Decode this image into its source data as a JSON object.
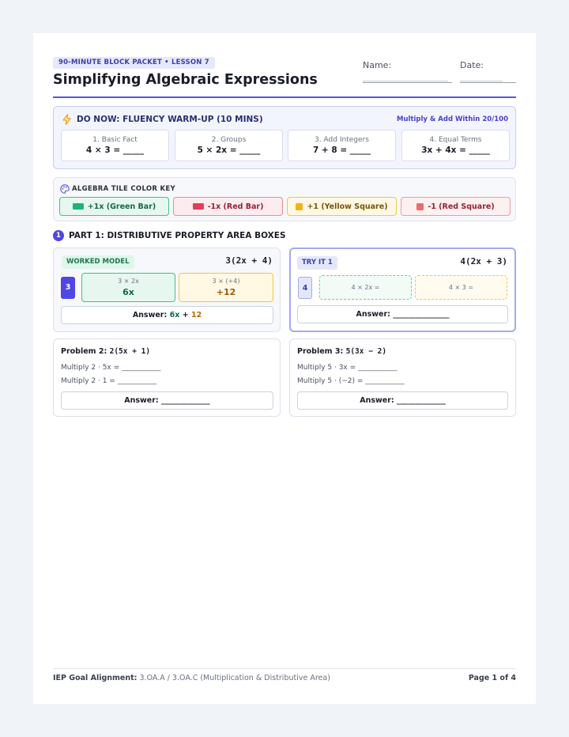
{
  "header": {
    "tag": "90-MINUTE BLOCK PACKET • LESSON 7",
    "title": "Simplifying Algebraic Expressions",
    "name_label": "Name:",
    "date_label": "Date:",
    "name_blank": "________________________",
    "date_blank": "____________"
  },
  "do_now": {
    "title": "DO NOW: FLUENCY WARM-UP (10 MINS)",
    "subtitle": "Multiply & Add Within 20/100",
    "cards": [
      {
        "label": "1. Basic Fact",
        "question": "4 × 3 = _____"
      },
      {
        "label": "2. Groups",
        "question": "5 × 2x = _____"
      },
      {
        "label": "3. Add Integers",
        "question": "7 + 8 = _____"
      },
      {
        "label": "4. Equal Terms",
        "question": "3x + 4x = _____"
      }
    ]
  },
  "color_key": {
    "title": "ALGEBRA TILE COLOR KEY",
    "chips": [
      {
        "label": "+1x (Green Bar)",
        "color": "#1fb37a"
      },
      {
        "label": "-1x (Red Bar)",
        "color": "#e03e5c"
      },
      {
        "label": "+1 (Yellow Square)",
        "color": "#f2b21b"
      },
      {
        "label": "-1 (Red Square)",
        "color": "#ee6b6b"
      }
    ]
  },
  "part1": {
    "number": "1",
    "title": "PART 1: DISTRIBUTIVE PROPERTY AREA BOXES",
    "worked_model": {
      "badge": "WORKED MODEL",
      "expression": "3(2x + 4)",
      "factor": "3",
      "cell1_small": "3 × 2x",
      "cell1_big": "6x",
      "cell2_small": "3 × (+4)",
      "cell2_big": "+12",
      "answer_label": "Answer:",
      "answer_term1": "6x",
      "answer_plus": "+",
      "answer_term2": "12"
    },
    "try_it": {
      "badge": "TRY IT 1",
      "expression": "4(2x + 3)",
      "factor": "4",
      "cell1": "4 × 2x =",
      "cell2": "4 × 3 =",
      "answer": "Answer: _______________"
    },
    "problem2": {
      "label": "Problem 2:",
      "expression": "2(5x + 1)",
      "line1": "Multiply 2 · 5x = ___________",
      "line2": "Multiply 2 · 1 = ___________",
      "answer": "Answer: _____________"
    },
    "problem3": {
      "label": "Problem 3:",
      "expression": "5(3x − 2)",
      "line1": "Multiply 5 · 3x = ___________",
      "line2": "Multiply 5 · (−2) = ___________",
      "answer": "Answer: _____________"
    }
  },
  "footer": {
    "goal_label": "IEP Goal Alignment:",
    "goal_text": "3.OA.A / 3.OA.C (Multiplication & Distributive Area)",
    "page": "Page 1 of 4"
  },
  "colors": {
    "accent": "#4f46e5",
    "green": "#1fb37a",
    "yellow": "#f2b21b"
  }
}
